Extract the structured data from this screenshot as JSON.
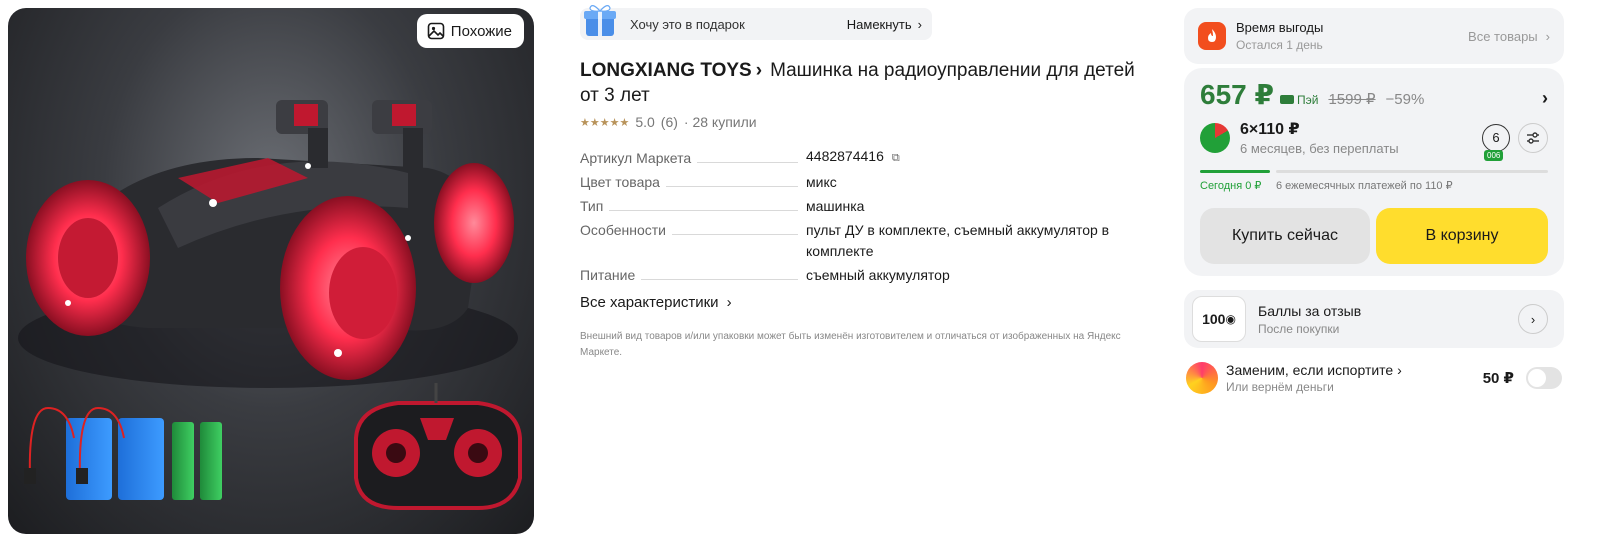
{
  "gallery": {
    "similar_label": "Похожие"
  },
  "gift": {
    "text": "Хочу это в подарок",
    "hint_label": "Намекнуть",
    "chevron": "›"
  },
  "product": {
    "brand": "LONGXIANG TOYS",
    "brand_chevron": "›",
    "title": "Машинка на радиоуправлении для детей от 3 лет",
    "stars": "★★★★★",
    "rating": "5.0",
    "reviews": "(6)",
    "purchases": "· 28 купили"
  },
  "specs": [
    {
      "key": "Артикул Маркета",
      "value": "4482874416"
    },
    {
      "key": "Цвет товара",
      "value": "микс"
    },
    {
      "key": "Тип",
      "value": "машинка"
    },
    {
      "key": "Особенности",
      "value": "пульт ДУ в комплекте, съемный аккумулятор в комплекте"
    },
    {
      "key": "Питание",
      "value": "съемный аккумулятор"
    }
  ],
  "all_chars_label": "Все характеристики",
  "disclaimer": "Внешний вид товаров и/или упаковки может быть изменён изготовителем и отличаться от изображенных на Яндекс Маркете.",
  "promo": {
    "title": "Время выгоды",
    "subtitle": "Остался 1 день",
    "all_label": "Все товары"
  },
  "price": {
    "current": "657 ₽",
    "pay_label": "Пэй",
    "old": "1599 ₽",
    "discount": "−59%"
  },
  "split": {
    "amount": "6×110 ₽",
    "terms": "6 месяцев, без переплаты",
    "months": "6",
    "mini": "006",
    "today": "Сегодня 0 ₽",
    "rest": "6 ежемесячных платежей по 110 ₽"
  },
  "actions": {
    "buy_now": "Купить сейчас",
    "add_to_cart": "В корзину"
  },
  "bonus": {
    "badge": "100",
    "title": "Баллы за отзыв",
    "subtitle": "После покупки"
  },
  "replace": {
    "title": "Заменим, если испортите ›",
    "subtitle": "Или вернём деньги",
    "price": "50 ₽"
  },
  "colors": {
    "accent_yellow": "#ffdd2d",
    "price_green": "#2e7d3a",
    "split_green": "#21a038",
    "fire_orange": "#f24e1e"
  }
}
